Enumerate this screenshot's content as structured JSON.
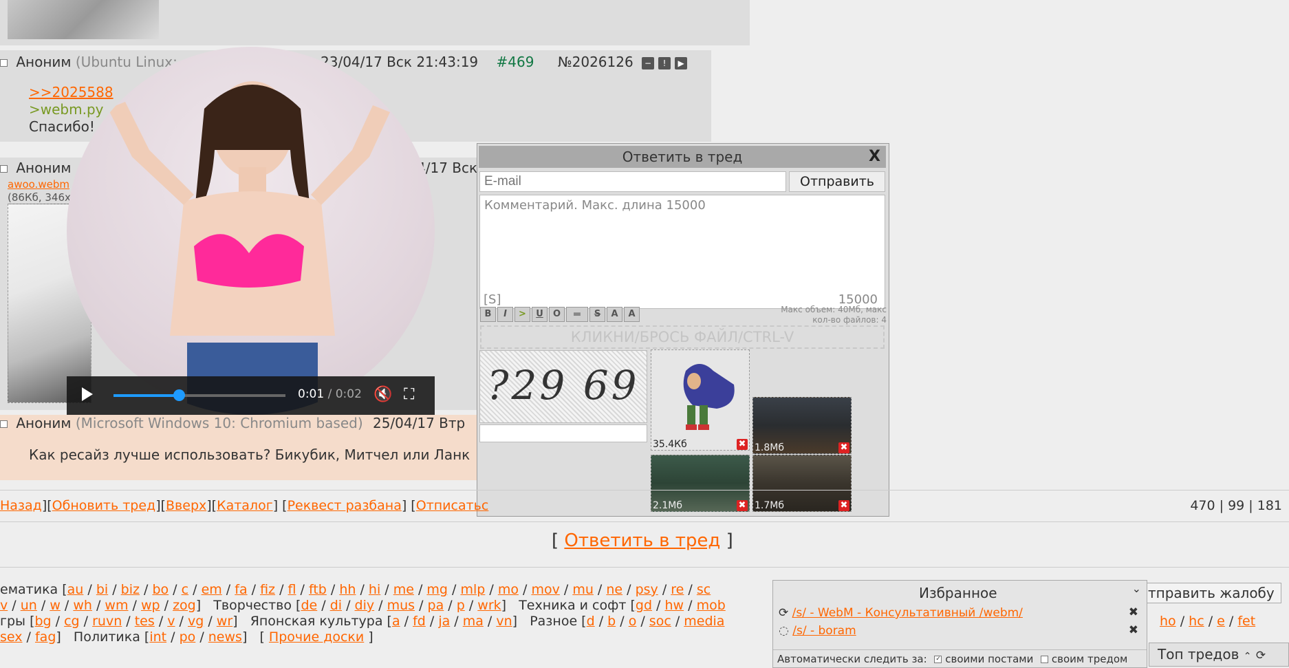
{
  "posts": {
    "p469": {
      "author": "Аноним",
      "os": "(Ubuntu Linux:",
      "date": "23/04/17 Вск 21:43:19",
      "index": "#469",
      "number": "№2026126",
      "lines": [
        ">>2025588",
        ">webm.py",
        "Спасибо!"
      ]
    },
    "p470": {
      "author": "Аноним",
      "date_partial": "4/17 Вск",
      "file_name": "awoo.webm",
      "file_info": "(86Кб, 346x"
    },
    "p471": {
      "author": "Аноним",
      "os": "(Microsoft Windows 10: Chromium based)",
      "date_partial": "25/04/17 Втр",
      "text": "Как ресайз лучше использовать? Бикубик, Митчел или Ланк"
    }
  },
  "video": {
    "time_current": "0:01",
    "time_sep": " / ",
    "time_total": "0:02",
    "progress": 0.38
  },
  "reply_form": {
    "title": "Ответить в тред",
    "close": "X",
    "email_placeholder": "E-mail",
    "send_label": "Отправить",
    "comment_placeholder": "Комментарий. Макс. длина 15000",
    "spoiler_tag": "[S]",
    "char_count": "15000",
    "toolbar": [
      "B",
      "I",
      ">",
      "U",
      "O",
      "▬",
      "S",
      "A",
      "A"
    ],
    "limits_line1": "Макс объем: 40Мб, макс",
    "limits_line2": "кол-во файлов: 4",
    "dropzone": "КЛИКНИ/БРОСЬ ФАЙЛ/CTRL-V",
    "captcha_text": "?29 69",
    "files": [
      {
        "size": "35.4Кб"
      },
      {
        "size": "1.8Мб"
      },
      {
        "size": "2.1Мб"
      },
      {
        "size": "1.7Мб"
      }
    ]
  },
  "navbar": {
    "links": [
      "Назад",
      "Обновить тред",
      "Вверх",
      "Каталог",
      "Реквест разбана",
      "Отписатьс"
    ],
    "stats": "470 | 99 | 181"
  },
  "reply_big": "Ответить в тред",
  "boards": {
    "row1_label": "ематика [",
    "row1": [
      "au",
      "bi",
      "biz",
      "bo",
      "c",
      "em",
      "fa",
      "fiz",
      "fl",
      "ftb",
      "hh",
      "hi",
      "me",
      "mg",
      "mlp",
      "mo",
      "mov",
      "mu",
      "ne",
      "psy",
      "re",
      "sc"
    ],
    "row2": [
      "v",
      "un",
      "w",
      "wh",
      "wm",
      "wp",
      "zog"
    ],
    "row2_cat2": "Творчество [",
    "row2_b": [
      "de",
      "di",
      "diy",
      "mus",
      "pa",
      "p",
      "wrk"
    ],
    "row2_cat3": "Техника и софт [",
    "row2_c": [
      "gd",
      "hw",
      "mob"
    ],
    "row3_label": "гры [",
    "row3": [
      "bg",
      "cg",
      "ruvn",
      "tes",
      "v",
      "vg",
      "wr"
    ],
    "row3_cat2": "Японская культура [",
    "row3_b": [
      "a",
      "fd",
      "ja",
      "ma",
      "vn"
    ],
    "row3_cat3": "Разное [",
    "row3_c": [
      "d",
      "b",
      "o",
      "soc",
      "media"
    ],
    "row3_right": [
      "ho",
      "hc",
      "e",
      "fet"
    ],
    "row4": [
      "sex",
      "fag"
    ],
    "row4_cat2": "Политика [",
    "row4_b": [
      "int",
      "po",
      "news"
    ],
    "row4_other": "Прочие доски"
  },
  "complaint_button": "Отправить жалобу",
  "favorites": {
    "title": "Избранное",
    "items": [
      "/s/ - WebM - Консультативный /webm/",
      "/s/ - boram"
    ],
    "auto_watch_label": "Автоматически следить за:",
    "own_posts": "своими постами",
    "own_thread": "своим тредом"
  },
  "top_threads": "Топ тредов"
}
